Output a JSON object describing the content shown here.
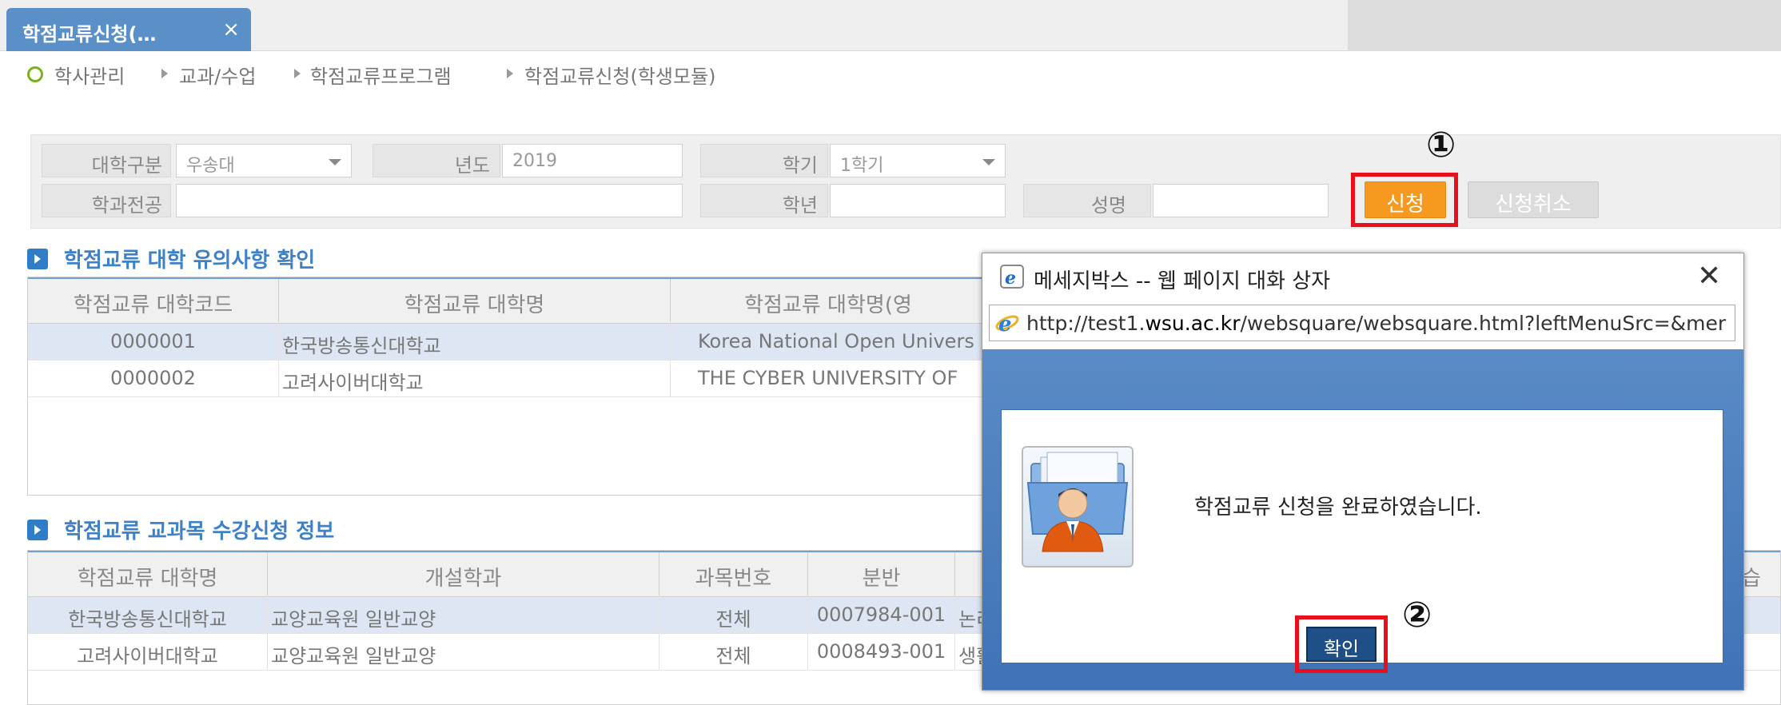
{
  "tab": {
    "label": "학점교류신청(…",
    "close": "×"
  },
  "breadcrumb": [
    "학사관리",
    "교과/수업",
    "학점교류프로그램",
    "학점교류신청(학생모듈)"
  ],
  "search": {
    "univ_label": "대학구분",
    "univ_value": "우송대",
    "year_label": "년도",
    "year_value": "2019",
    "semester_label": "학기",
    "semester_value": "1학기",
    "dept_label": "학과전공",
    "dept_value": "",
    "grade_label": "학년",
    "grade_value": "",
    "name_label": "성명",
    "name_value": ""
  },
  "buttons": {
    "apply": "신청",
    "cancel": "신청취소"
  },
  "annotations": {
    "step1": "①",
    "step2": "②"
  },
  "section1": {
    "title": "학점교류 대학 유의사항 확인",
    "headers": [
      "학점교류 대학코드",
      "학점교류 대학명",
      "학점교류 대학명(영"
    ],
    "rows": [
      [
        "0000001",
        "한국방송통신대학교",
        "Korea National Open Univers"
      ],
      [
        "0000002",
        "고려사이버대학교",
        "THE CYBER UNIVERSITY OF"
      ]
    ]
  },
  "section2": {
    "title": "학점교류 교과목 수강신청 정보",
    "headers": [
      "학점교류 대학명",
      "개설학과",
      "과목번호",
      "분반",
      "",
      "습"
    ],
    "rows": [
      [
        "한국방송통신대학교",
        "교양교육원 일반교양",
        "전체",
        "0007984-001",
        "논리"
      ],
      [
        "고려사이버대학교",
        "교양교육원 일반교양",
        "전체",
        "0008493-001",
        "생활"
      ]
    ]
  },
  "dialog": {
    "title": "메세지박스 -- 웹 페이지 대화 상자",
    "close": "✕",
    "url_prefix": "http://test1.",
    "url_domain": "wsu.ac.kr",
    "url_rest": "/websquare/websquare.html?leftMenuSrc=&mer",
    "message": "학점교류 신청을 완료하였습니다.",
    "ok": "확인",
    "icon": "user-folder-icon"
  },
  "colors": {
    "tab": "#5b8fc8",
    "apply": "#f59a1e",
    "highlight": "#e8101c",
    "dialog_body": "#4a7fbf"
  }
}
